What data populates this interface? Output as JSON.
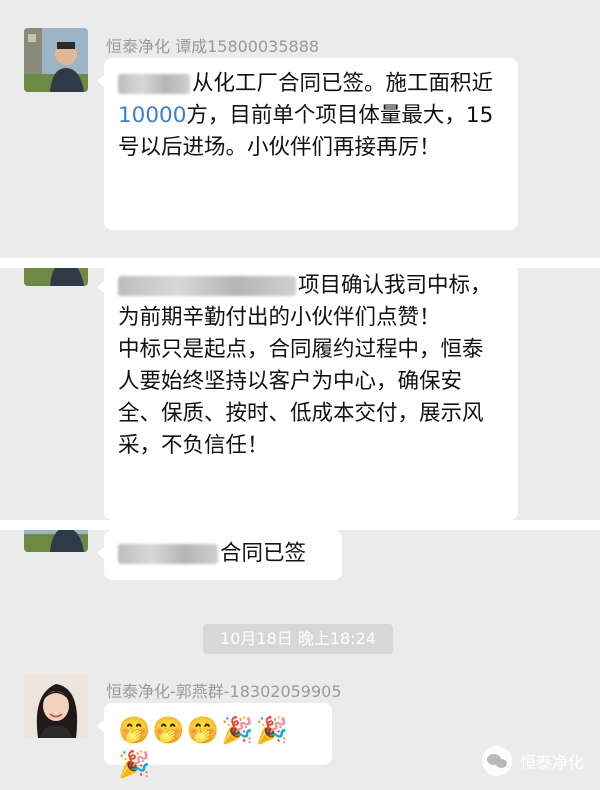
{
  "messages": [
    {
      "sender": "恒泰净化 谭成15800035888",
      "text_before_highlight": "从化工厂合同已签。施工面积近",
      "highlight": "10000",
      "text_after_highlight": "方，目前单个项目体量最大，15号以后进场。小伙伴们再接再厉！"
    },
    {
      "sender": "恒泰净化 谭成15800035888",
      "text_line1": "项目确认我司中标，为前期辛勤付出的小伙伴们点赞！",
      "text_line2": "中标只是起点，合同履约过程中，恒泰人要始终坚持以客户为中心，确保安全、保质、按时、低成本交付，展示风采，不负信任！"
    },
    {
      "text": "合同已签"
    }
  ],
  "timestamp": "10月18日 晚上18:24",
  "last_message": {
    "sender": "恒泰净化-郭燕群-18302059905",
    "emoji": [
      "🤭",
      "🤭",
      "🤭",
      "🎉",
      "🎉",
      "🎉"
    ]
  },
  "watermark": "恒泰净化",
  "colors": {
    "background": "#ebebeb",
    "bubble": "#ffffff",
    "highlight": "#3b7dd8",
    "name": "#9a9a9a"
  }
}
